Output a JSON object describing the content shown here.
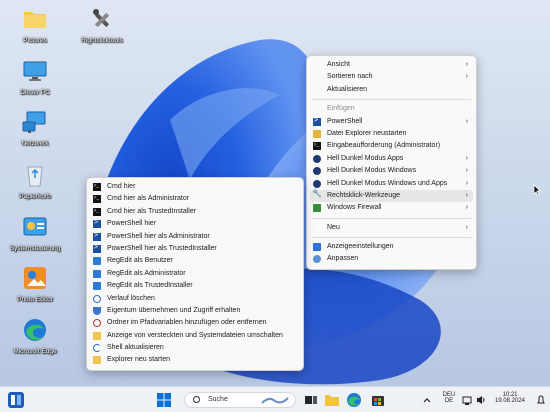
{
  "desktop_icons": [
    {
      "label": "Pictures",
      "icon": "folder-icon"
    },
    {
      "label": "Rightclicktools",
      "icon": "tools-icon"
    },
    {
      "label": "Dieser PC",
      "icon": "monitor-icon"
    },
    {
      "label": "Netzwerk",
      "icon": "network-icon"
    },
    {
      "label": "Papierkorb",
      "icon": "recycle-bin-icon"
    },
    {
      "label": "Systemsteuerung",
      "icon": "control-panel-icon"
    },
    {
      "label": "Photo Editor",
      "icon": "photo-editor-icon"
    },
    {
      "label": "Microsoft Edge",
      "icon": "edge-icon"
    }
  ],
  "desktop_menu": {
    "items": [
      {
        "label": "Ansicht",
        "submenu": true,
        "icon": null
      },
      {
        "label": "Sortieren nach",
        "submenu": true,
        "icon": null
      },
      {
        "label": "Aktualisieren",
        "submenu": false,
        "icon": null
      },
      {
        "separator": true
      },
      {
        "label": "Einfügen",
        "submenu": false,
        "disabled": true,
        "icon": null
      },
      {
        "label": "PowerShell",
        "submenu": true,
        "icon": "powershell-icon"
      },
      {
        "label": "Datei Explorer neustarten",
        "submenu": false,
        "icon": "folder-icon"
      },
      {
        "label": "Eingabeaufforderung (Administrator)",
        "submenu": false,
        "icon": "cmd-icon"
      },
      {
        "label": "Hell Dunkel Modus Apps",
        "submenu": true,
        "icon": "theme-icon"
      },
      {
        "label": "Hell Dunkel Modus Windows",
        "submenu": true,
        "icon": "theme-icon"
      },
      {
        "label": "Hell Dunkel Modus Windows und Apps",
        "submenu": true,
        "icon": "theme-icon"
      },
      {
        "label": "Rechtsklick-Werkzeuge",
        "submenu": true,
        "highlighted": true,
        "icon": "wrench-icon"
      },
      {
        "label": "Windows Firewall",
        "submenu": true,
        "icon": "firewall-icon"
      },
      {
        "separator": true
      },
      {
        "label": "Neu",
        "submenu": true,
        "icon": null
      },
      {
        "separator": true
      },
      {
        "label": "Anzeigeeinstellungen",
        "submenu": false,
        "icon": "display-icon"
      },
      {
        "label": "Anpassen",
        "submenu": false,
        "icon": "personalize-icon"
      }
    ]
  },
  "tools_submenu": {
    "items": [
      {
        "label": "Cmd hier",
        "icon": "cmd-icon"
      },
      {
        "label": "Cmd hier als Administrator",
        "icon": "cmd-icon"
      },
      {
        "label": "Cmd hier als TrustedInstaller",
        "icon": "cmd-icon"
      },
      {
        "label": "PowerShell hier",
        "icon": "powershell-icon"
      },
      {
        "label": "PowerShell hier als Administrator",
        "icon": "powershell-icon"
      },
      {
        "label": "PowerShell hier als TrustedInstaller",
        "icon": "powershell-icon"
      },
      {
        "label": "RegEdit als Benutzer",
        "icon": "regedit-icon"
      },
      {
        "label": "RegEdit als Administrator",
        "icon": "regedit-icon"
      },
      {
        "label": "RegEdit als TrustedInstaller",
        "icon": "regedit-icon"
      },
      {
        "label": "Verlauf löschen",
        "icon": "clock-icon"
      },
      {
        "label": "Eigentum übernehmen und Zugriff erhalten",
        "icon": "shield-icon"
      },
      {
        "label": "Ordner im Pfadvariablen hinzufügen oder entfernen",
        "icon": "no-entry-icon"
      },
      {
        "label": "Anzeige von versteckten und Systemdateien umschalten",
        "icon": "folder-eye-icon"
      },
      {
        "label": "Shell aktualisieren",
        "icon": "refresh-icon"
      },
      {
        "label": "Explorer neu starten",
        "icon": "explorer-icon"
      }
    ]
  },
  "taskbar": {
    "search_placeholder": "Suche",
    "language": "DEU",
    "layout": "DE",
    "time": "10:21",
    "date": "19.08.2024"
  },
  "colors": {
    "menu_bg": "#f9f9f9",
    "highlight": "#e6e6e6",
    "accent": "#0067c0"
  }
}
